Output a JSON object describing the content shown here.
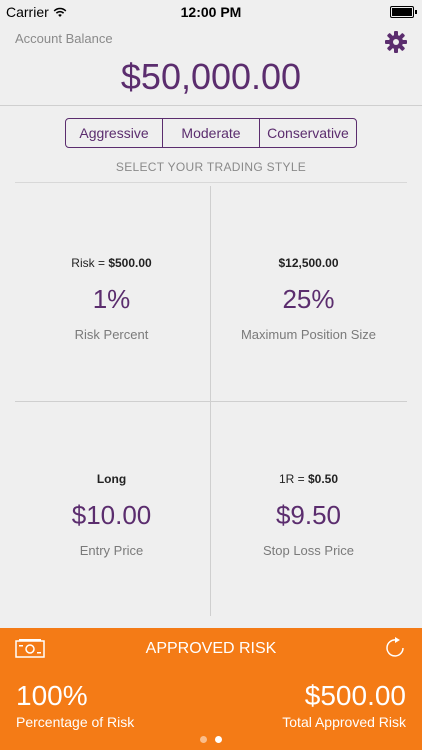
{
  "status_bar": {
    "carrier": "Carrier",
    "time": "12:00 PM"
  },
  "account": {
    "label": "Account Balance",
    "balance": "$50,000.00"
  },
  "trading_style": {
    "options": [
      "Aggressive",
      "Moderate",
      "Conservative"
    ],
    "caption": "SELECT YOUR TRADING STYLE"
  },
  "cells": {
    "risk_percent": {
      "top_prefix": "Risk = ",
      "top_value": "$500.00",
      "value": "1%",
      "label": "Risk Percent"
    },
    "max_position": {
      "top_value": "$12,500.00",
      "value": "25%",
      "label": "Maximum Position Size"
    },
    "entry_price": {
      "top_value": "Long",
      "value": "$10.00",
      "label": "Entry Price"
    },
    "stop_loss": {
      "top_prefix": "1R = ",
      "top_value": "$0.50",
      "value": "$9.50",
      "label": "Stop Loss Price"
    }
  },
  "approved": {
    "title": "APPROVED RISK",
    "percentage": "100%",
    "percentage_label": "Percentage of Risk",
    "amount": "$500.00",
    "amount_label": "Total Approved Risk",
    "page_count": 2,
    "active_page": 2
  },
  "colors": {
    "accent": "#5b2d6e",
    "orange": "#f47b16"
  }
}
